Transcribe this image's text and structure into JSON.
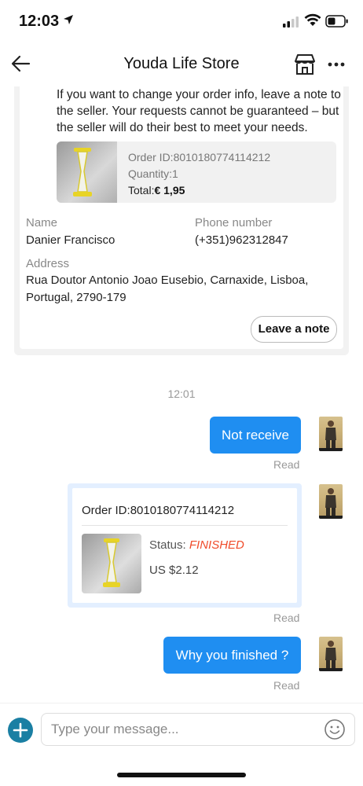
{
  "status_bar": {
    "time": "12:03"
  },
  "header": {
    "title": "Youda Life Store"
  },
  "info_card": {
    "message": "If you want to change your order info, leave a note to the seller. Your requests cannot be guaranteed – but the seller will do their best to meet your needs.",
    "order": {
      "id_label": "Order ID:",
      "id_value": "8010180774114212",
      "quantity_label": "Quantity:",
      "quantity_value": "1",
      "total_label": "Total:",
      "total_value": "€ 1,95"
    },
    "name_label": "Name",
    "name_value": "Danier Francisco",
    "phone_label": "Phone number",
    "phone_value": "(+351)962312847",
    "address_label": "Address",
    "address_line1": "Rua Doutor Antonio Joao Eusebio, Carnaxide, Lisboa,",
    "address_line2": "Portugal, 2790-179",
    "leave_note_label": "Leave a note"
  },
  "chat": {
    "timestamp": "12:01",
    "messages": [
      {
        "text": "Not receive",
        "read": "Read"
      },
      {
        "read": "Read"
      },
      {
        "text": "Why you finished ?",
        "read": "Read"
      }
    ],
    "order_card": {
      "id_label": "Order ID:",
      "id_value": "8010180774114212",
      "status_label": "Status: ",
      "status_value": "FINISHED",
      "price": "US $2.12"
    }
  },
  "input": {
    "placeholder": "Type your message..."
  },
  "colors": {
    "accent": "#1f8ef1",
    "status_finished": "#f04b2a",
    "add_button": "#1a7fa3"
  }
}
